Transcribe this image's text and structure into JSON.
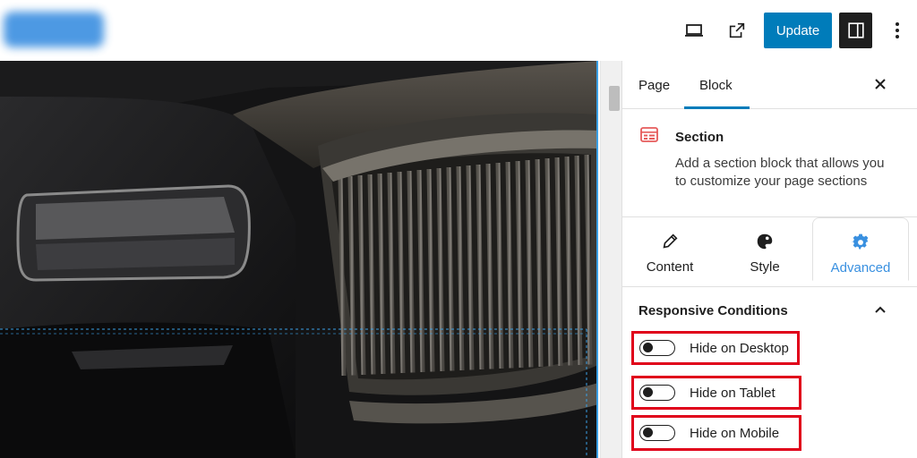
{
  "topbar": {
    "update_label": "Update",
    "icons": [
      "desktop-preview-icon",
      "external-link-icon",
      "sidebar-toggle-icon",
      "more-options-icon"
    ]
  },
  "sidebar": {
    "tabs": [
      {
        "label": "Page"
      },
      {
        "label": "Block",
        "active": true
      }
    ],
    "block": {
      "title": "Section",
      "description": "Add a section block that allows you to customize your page sections"
    },
    "inner_tabs": [
      {
        "label": "Content",
        "icon": "pencil-icon"
      },
      {
        "label": "Style",
        "icon": "palette-icon"
      },
      {
        "label": "Advanced",
        "icon": "gear-icon",
        "active": true
      }
    ],
    "panel": {
      "title": "Responsive Conditions",
      "toggles": [
        {
          "label": "Hide on Desktop",
          "checked": false
        },
        {
          "label": "Hide on Tablet",
          "checked": false
        },
        {
          "label": "Hide on Mobile",
          "checked": false
        }
      ]
    }
  },
  "colors": {
    "accent": "#007cba",
    "advanced_tab": "#3990e0",
    "highlight_border": "#e0001a",
    "block_icon": "#e65b5b"
  }
}
